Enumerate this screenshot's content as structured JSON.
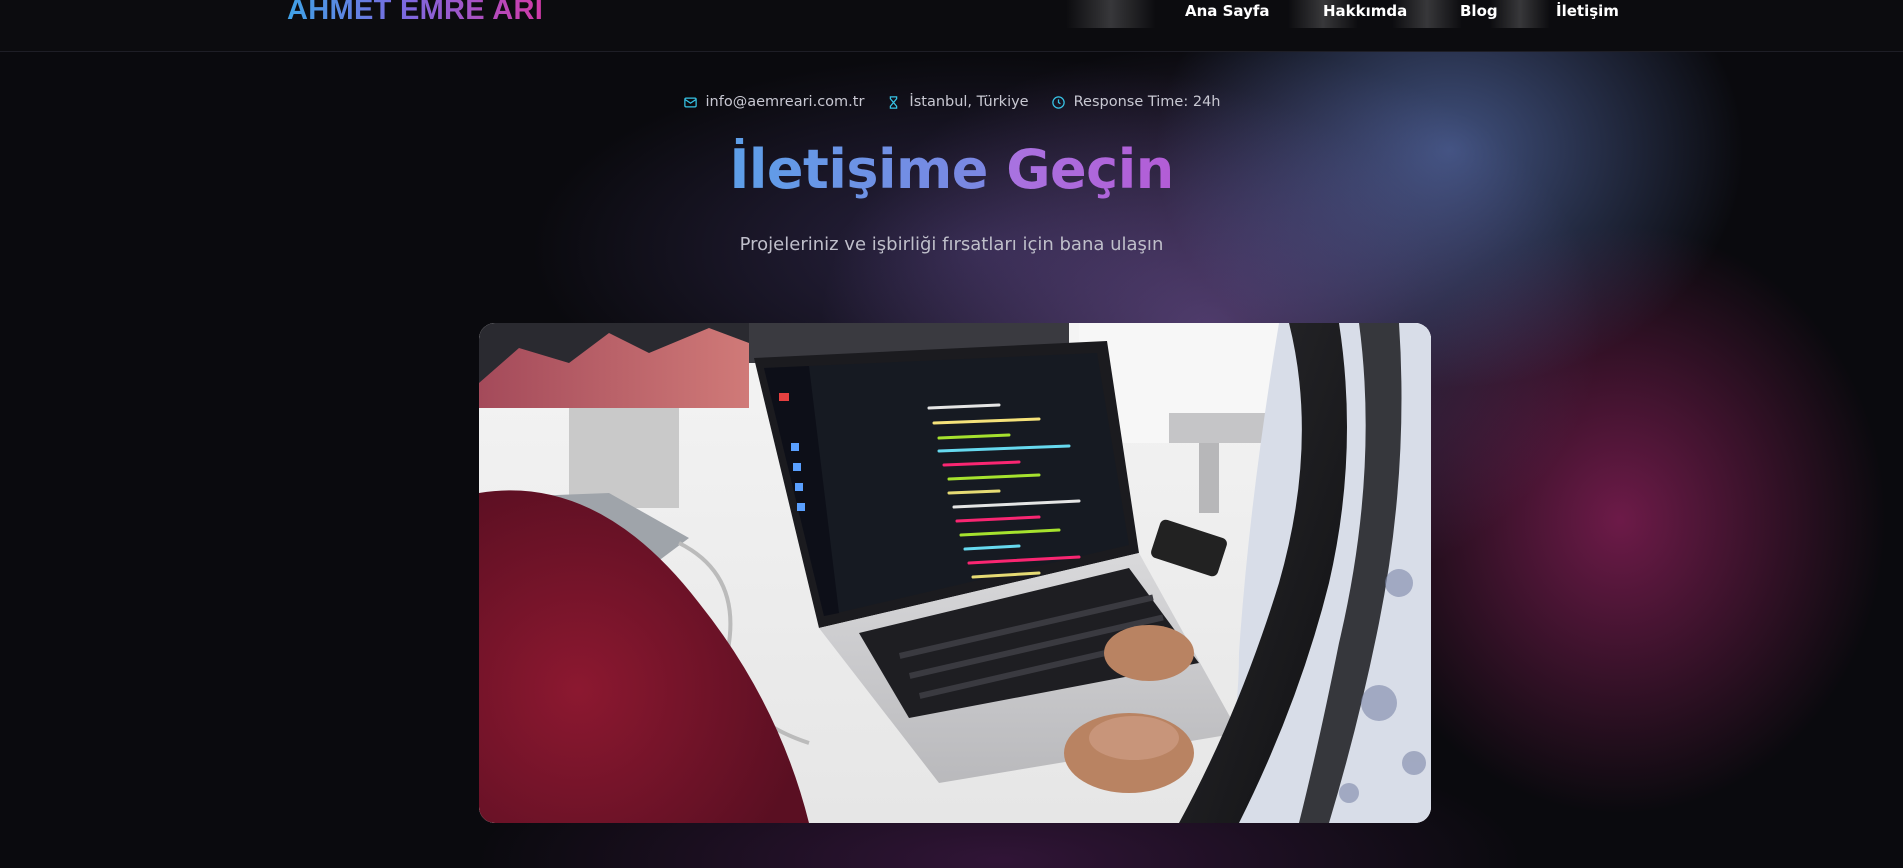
{
  "header": {
    "logo_text": "AHMET EMRE ARI",
    "nav": [
      {
        "label": "Ana Sayfa"
      },
      {
        "label": "Hakkımda"
      },
      {
        "label": "Blog"
      },
      {
        "label": "İletişim"
      }
    ]
  },
  "contact": {
    "email": {
      "icon": "mail-icon",
      "text": "info@aemreari.com.tr"
    },
    "location": {
      "icon": "hourglass-icon",
      "text": "İstanbul, Türkiye"
    },
    "response": {
      "icon": "clock-icon",
      "text": "Response Time: 24h"
    }
  },
  "hero": {
    "title_part1": "İletişime",
    "title_part2": "Geçin",
    "subtitle": "Projeleriniz ve işbirliği fırsatları için bana ulaşın"
  },
  "image": {
    "description_icon": "laptop-coding-photo"
  },
  "colors": {
    "accent_cyan": "#37c4e6",
    "accent_blue": "#5d9fe8",
    "accent_purple": "#a873e0",
    "accent_pink": "#d23aa8",
    "background": "#0a0a0e"
  }
}
